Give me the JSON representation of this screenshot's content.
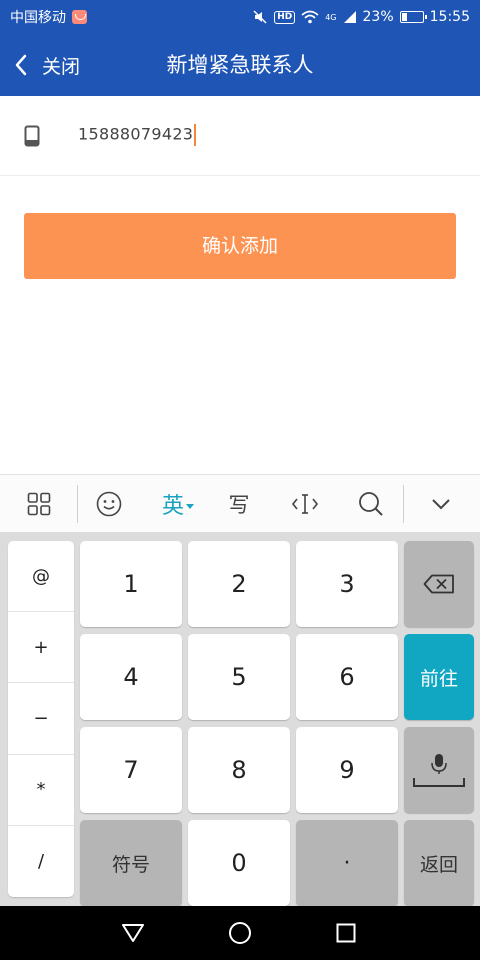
{
  "status_bar": {
    "carrier": "中国移动",
    "hd_label": "HD",
    "network": "4G",
    "battery_level": 0.23,
    "battery_text": "23%",
    "time": "15:55"
  },
  "header": {
    "back_label": "关闭",
    "title": "新增紧急联系人"
  },
  "form": {
    "phone_value": "15888079423",
    "confirm_label": "确认添加"
  },
  "keyboard": {
    "toolbar": {
      "lang_label": "英",
      "handwrite_label": "写"
    },
    "symbol_keys": [
      "@",
      "+",
      "−",
      "*",
      "/"
    ],
    "digits": [
      "1",
      "2",
      "3",
      "4",
      "5",
      "6",
      "7",
      "8",
      "9",
      "0"
    ],
    "symbols_label": "符号",
    "dot_label": "·",
    "go_label": "前往",
    "return_label": "返回"
  },
  "colors": {
    "header_bg": "#1f56b5",
    "confirm_bg": "#fd9352",
    "go_key_bg": "#11a7c2"
  }
}
